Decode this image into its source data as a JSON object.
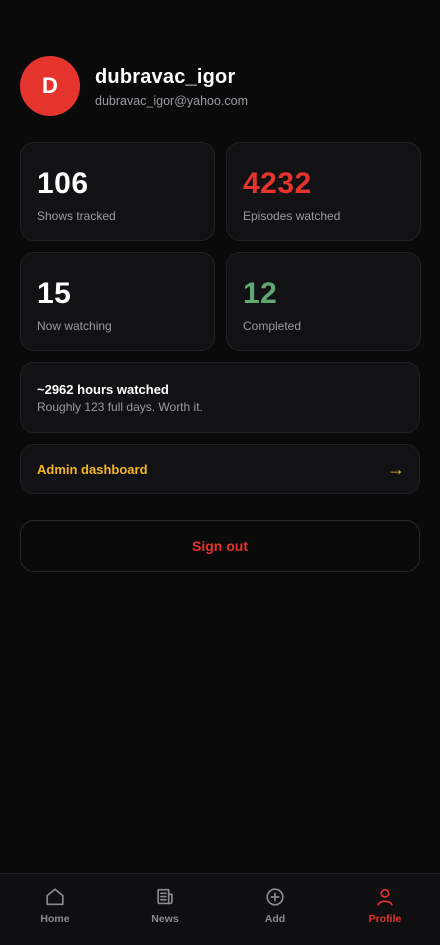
{
  "profile": {
    "initial": "D",
    "username": "dubravac_igor",
    "email": "dubravac_igor@yahoo.com"
  },
  "stats": [
    {
      "value": "106",
      "label": "Shows tracked"
    },
    {
      "value": "4232",
      "label": "Episodes watched"
    },
    {
      "value": "15",
      "label": "Now watching"
    },
    {
      "value": "12",
      "label": "Completed"
    }
  ],
  "hours": {
    "title": "~2962 hours watched",
    "subtitle": "Roughly 123 full days. Worth it."
  },
  "admin": {
    "label": "Admin dashboard",
    "arrow": "→"
  },
  "signout": {
    "label": "Sign out"
  },
  "nav": {
    "active": "Profile",
    "items": [
      {
        "label": "Home",
        "icon": "home-icon"
      },
      {
        "label": "News",
        "icon": "news-icon"
      },
      {
        "label": "Add",
        "icon": "add-icon"
      },
      {
        "label": "Profile",
        "icon": "profile-icon"
      }
    ]
  },
  "colors": {
    "accent": "#e5332d",
    "admin": "#f3b523",
    "completed": "#5fa873",
    "background": "#0a0a0b"
  }
}
